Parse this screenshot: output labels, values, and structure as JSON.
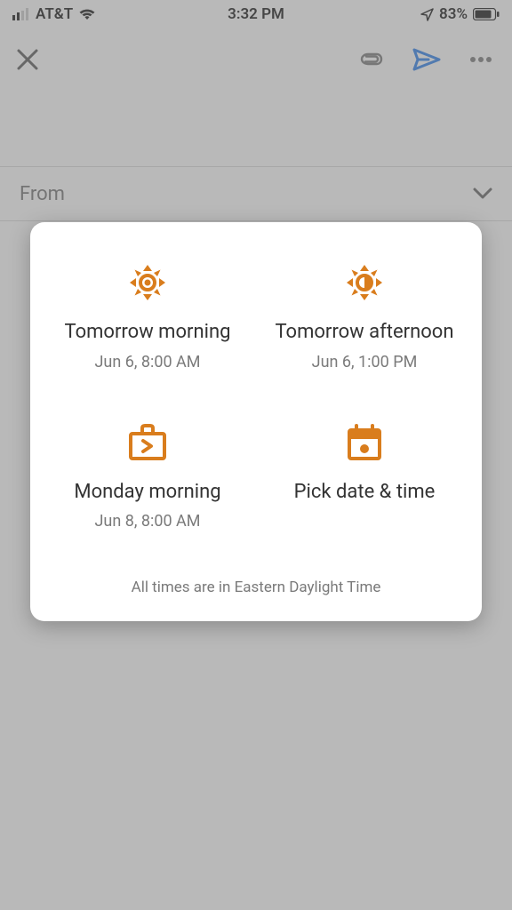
{
  "status": {
    "carrier": "AT&T",
    "time": "3:32 PM",
    "battery": "83%"
  },
  "compose": {
    "from_label": "From"
  },
  "schedule": {
    "options": [
      {
        "label": "Tomorrow morning",
        "sub": "Jun 6, 8:00 AM"
      },
      {
        "label": "Tomorrow afternoon",
        "sub": "Jun 6, 1:00 PM"
      },
      {
        "label": "Monday morning",
        "sub": "Jun 8, 8:00 AM"
      },
      {
        "label": "Pick date & time",
        "sub": ""
      }
    ],
    "footer": "All times are in Eastern Daylight Time"
  },
  "colors": {
    "accent": "#d97d1d",
    "send": "#1a73e8"
  }
}
